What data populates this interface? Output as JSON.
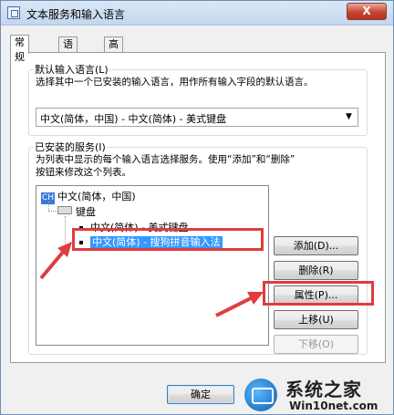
{
  "window": {
    "title": "文本服务和输入语言",
    "close_label": "X"
  },
  "tabs": [
    "常规",
    "语言栏",
    "高级键设置"
  ],
  "default_group": {
    "title": "默认输入语言(L)",
    "description": "选择其中一个已安装的输入语言，用作所有输入字段的默认语言。",
    "selected": "中文(简体，中国) - 中文(简体) - 美式键盘"
  },
  "installed_group": {
    "title": "已安装的服务(I)",
    "description_line1": "为列表中显示的每个输入语言选择服务。使用“添加”和“删除”",
    "description_line2": "按钮来修改这个列表。"
  },
  "tree": {
    "lang_badge": "CH",
    "language": "中文(简体，中国)",
    "category": "键盘",
    "items": [
      "中文(简体) - 美式键盘",
      "中文(简体) - 搜狗拼音输入法"
    ]
  },
  "buttons": {
    "add": "添加(D)...",
    "remove": "删除(R)",
    "properties": "属性(P)...",
    "move_up": "上移(U)",
    "move_down": "下移(O)",
    "ok": "确定"
  },
  "watermark": {
    "title": "系统之家",
    "url": "Win10net.com"
  },
  "colors": {
    "highlight": "#e03c3c",
    "selection": "#3399ff"
  }
}
